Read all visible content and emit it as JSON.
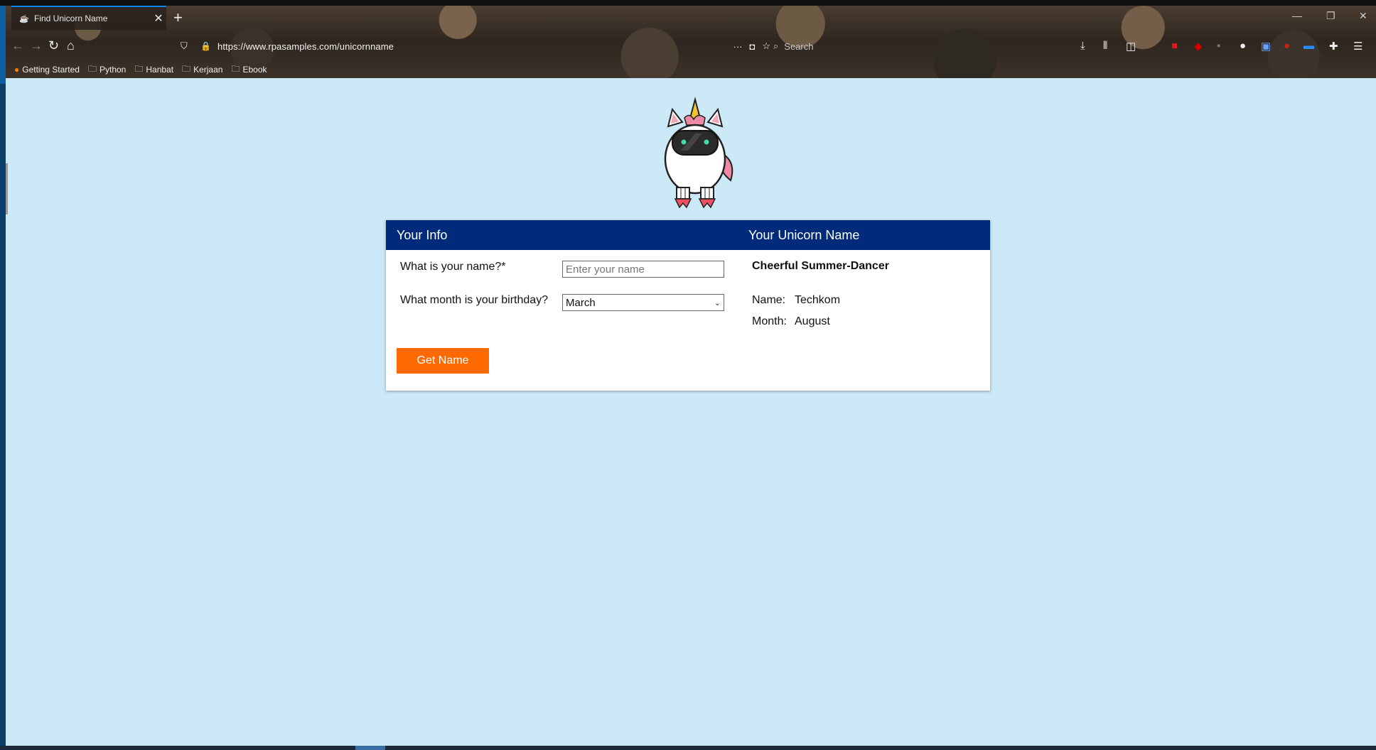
{
  "browser": {
    "tab_title": "Find Unicorn Name",
    "tab_favicon": "unicorn-favicon",
    "url": "https://www.rpasamples.com/unicornname",
    "search_placeholder": "Search",
    "bookmarks": [
      "Getting Started",
      "Python",
      "Hanbat",
      "Kerjaan",
      "Ebook"
    ]
  },
  "form": {
    "left_header": "Your Info",
    "right_header": "Your Unicorn Name",
    "name_label": "What is your name?*",
    "name_placeholder": "Enter your name",
    "name_value": "",
    "month_label": "What month is your birthday?",
    "month_selected": "March",
    "button_label": "Get Name"
  },
  "result": {
    "unicorn_name": "Cheerful Summer-Dancer",
    "name_label": "Name:",
    "name_value": "Techkom",
    "month_label": "Month:",
    "month_value": "August"
  },
  "colors": {
    "page_bg": "#cce9f7",
    "header_bg": "#002a7a",
    "button_bg": "#ff6a00"
  }
}
